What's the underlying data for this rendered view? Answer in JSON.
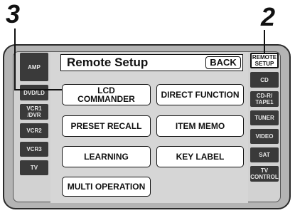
{
  "callouts": {
    "step_left": "3",
    "step_right": "2"
  },
  "screen": {
    "title": "Remote Setup",
    "back_label": "BACK"
  },
  "menu": {
    "lcd_commander": "LCD\nCOMMANDER",
    "direct_function": "DIRECT FUNCTION",
    "preset_recall": "PRESET RECALL",
    "item_memo": "ITEM MEMO",
    "learning": "LEARNING",
    "key_label": "KEY LABEL",
    "multi_operation": "MULTI OPERATION"
  },
  "left_buttons": {
    "amp": "AMP",
    "dvd_ld": "DVD/LD",
    "vcr1_dvr": "VCR1\n/DVR",
    "vcr2": "VCR2",
    "vcr3": "VCR3",
    "tv": "TV"
  },
  "right_buttons": {
    "remote_setup": "REMOTE\nSETUP",
    "cd": "CD",
    "cd_r_tape1": "CD-R/\nTAPE1",
    "tuner": "TUNER",
    "video": "VIDEO",
    "sat": "SAT",
    "tv_control": "TV\nCONTROL"
  },
  "colors": {
    "frame": "#b4b4b4",
    "side_button": "#3a3a3a",
    "selected_button": "#ffffff"
  }
}
